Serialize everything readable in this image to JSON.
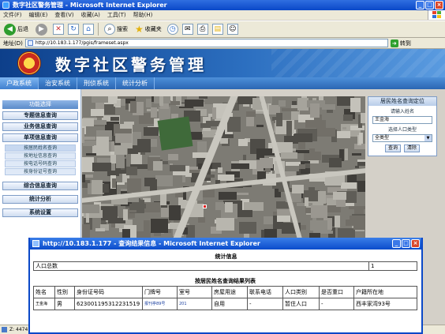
{
  "browser": {
    "title": "数字社区警务管理 - Microsoft Internet Explorer",
    "menu": [
      "文件(F)",
      "编辑(E)",
      "查看(V)",
      "收藏(A)",
      "工具(T)",
      "帮助(H)"
    ],
    "toolbar": {
      "back": "后退",
      "search": "搜索",
      "favorites": "收藏夹"
    },
    "address_label": "地址(D)",
    "address_url": "http://10.183.1.177/pgis/frameset.aspx",
    "go_label": "转到",
    "status_text": "Z: 4474"
  },
  "site": {
    "title": "数字社区警务管理",
    "nav": [
      "户政系统",
      "治安系统",
      "刑侦系统",
      "统计分析"
    ]
  },
  "sidebar": {
    "header": "功能选择",
    "items": [
      {
        "label": "专题信息查询"
      },
      {
        "label": "业务信息查询"
      },
      {
        "label": "单项信息查询"
      }
    ],
    "sub_items": [
      "按居民姓名查询",
      "按地址信息查询",
      "按电话号码查询",
      "按身份证号查询"
    ],
    "more_items": [
      {
        "label": "综合信息查询"
      },
      {
        "label": "统计分析"
      },
      {
        "label": "系统设置"
      }
    ]
  },
  "right_panel": {
    "title": "居民姓名查询定位",
    "name_label": "请输入姓名",
    "name_value": "王金海",
    "type_label": "选择人口类型",
    "type_value": "全类型",
    "query_button": "查询",
    "clear_button": "清除"
  },
  "popup": {
    "title": "http://10.183.1.177 - 查询结果信息 - Microsoft Internet Explorer",
    "stats_caption": "统计信息",
    "stats_label": "人口总数",
    "stats_value": "1",
    "results_caption": "按居民姓名查询结果列表",
    "columns": [
      "姓名",
      "性别",
      "身份证号码",
      "门牌号",
      "室号",
      "房屋用途",
      "联系电话",
      "人口类别",
      "是否重口",
      "户籍所在地"
    ],
    "rows": [
      {
        "name": "王金海",
        "sex": "男",
        "id": "623001195312231519",
        "door": "报刊亭89号",
        "room": "201",
        "use": "自用",
        "phone": "-",
        "category": "暂住人口",
        "key": "-",
        "origin": "西丰家湾93号"
      }
    ]
  }
}
